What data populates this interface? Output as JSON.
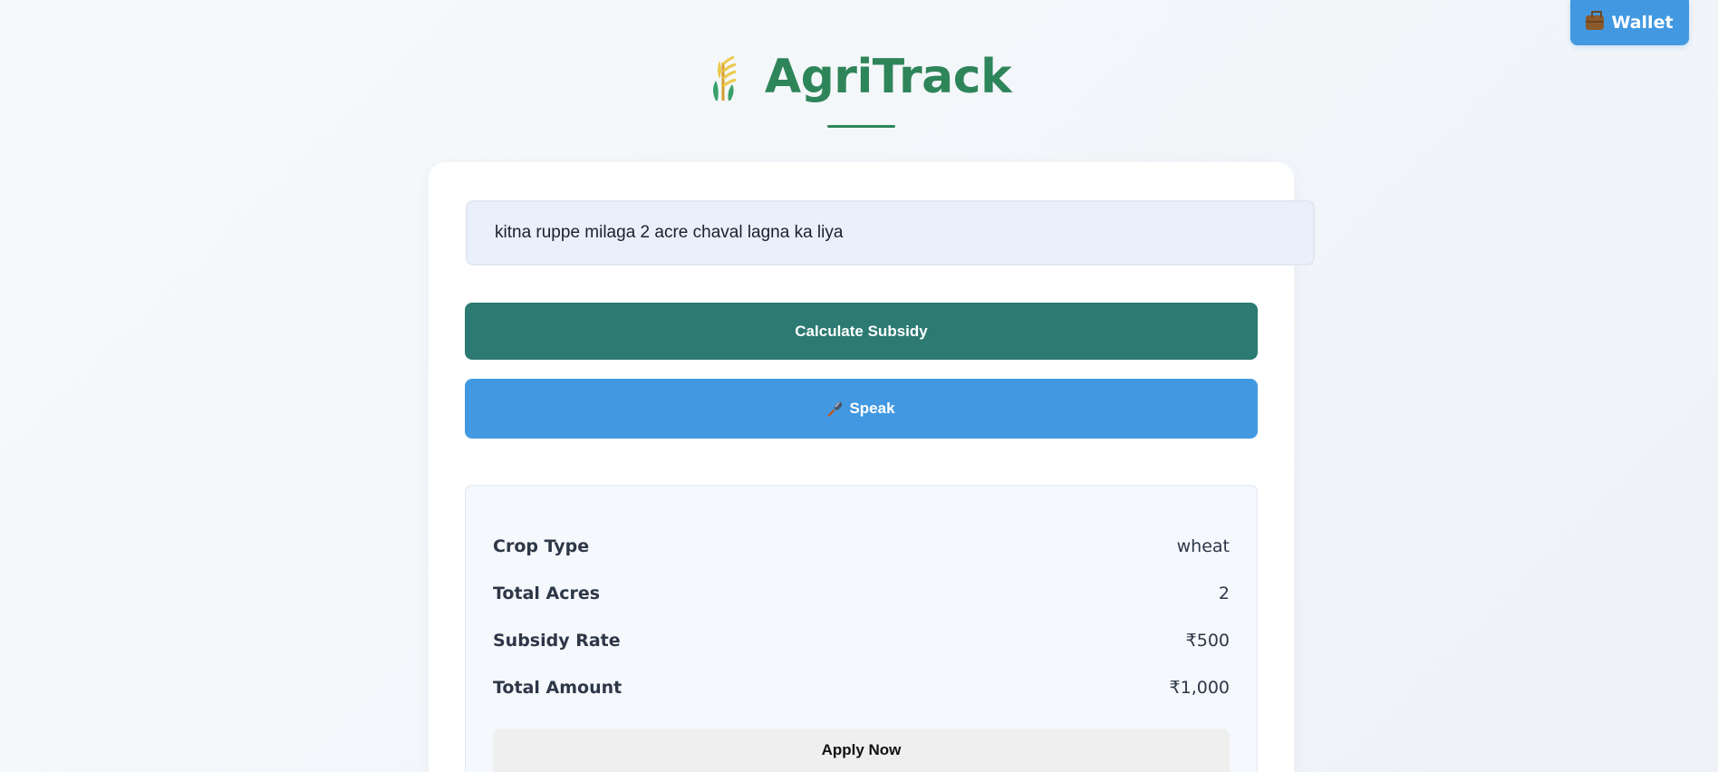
{
  "wallet": {
    "label": "Wallet",
    "icon": "briefcase-icon"
  },
  "header": {
    "title": "AgriTrack",
    "logo_icon": "wheat-sprout-icon",
    "title_color": "#2f855a"
  },
  "query": {
    "value": "kitna ruppe milaga 2 acre chaval lagna ka liya"
  },
  "actions": {
    "calculate_label": "Calculate Subsidy",
    "speak_label": "Speak",
    "speak_icon": "microphone-icon"
  },
  "result": {
    "rows": [
      {
        "label": "Crop Type",
        "value": "wheat"
      },
      {
        "label": "Total Acres",
        "value": "2"
      },
      {
        "label": "Subsidy Rate",
        "value": "₹500"
      },
      {
        "label": "Total Amount",
        "value": "₹1,000"
      }
    ],
    "apply_label": "Apply Now"
  },
  "colors": {
    "accent_green": "#2f855a",
    "calculate_bg": "#2c7a72",
    "speak_bg": "#4299e1",
    "wallet_bg": "#4299e1"
  }
}
